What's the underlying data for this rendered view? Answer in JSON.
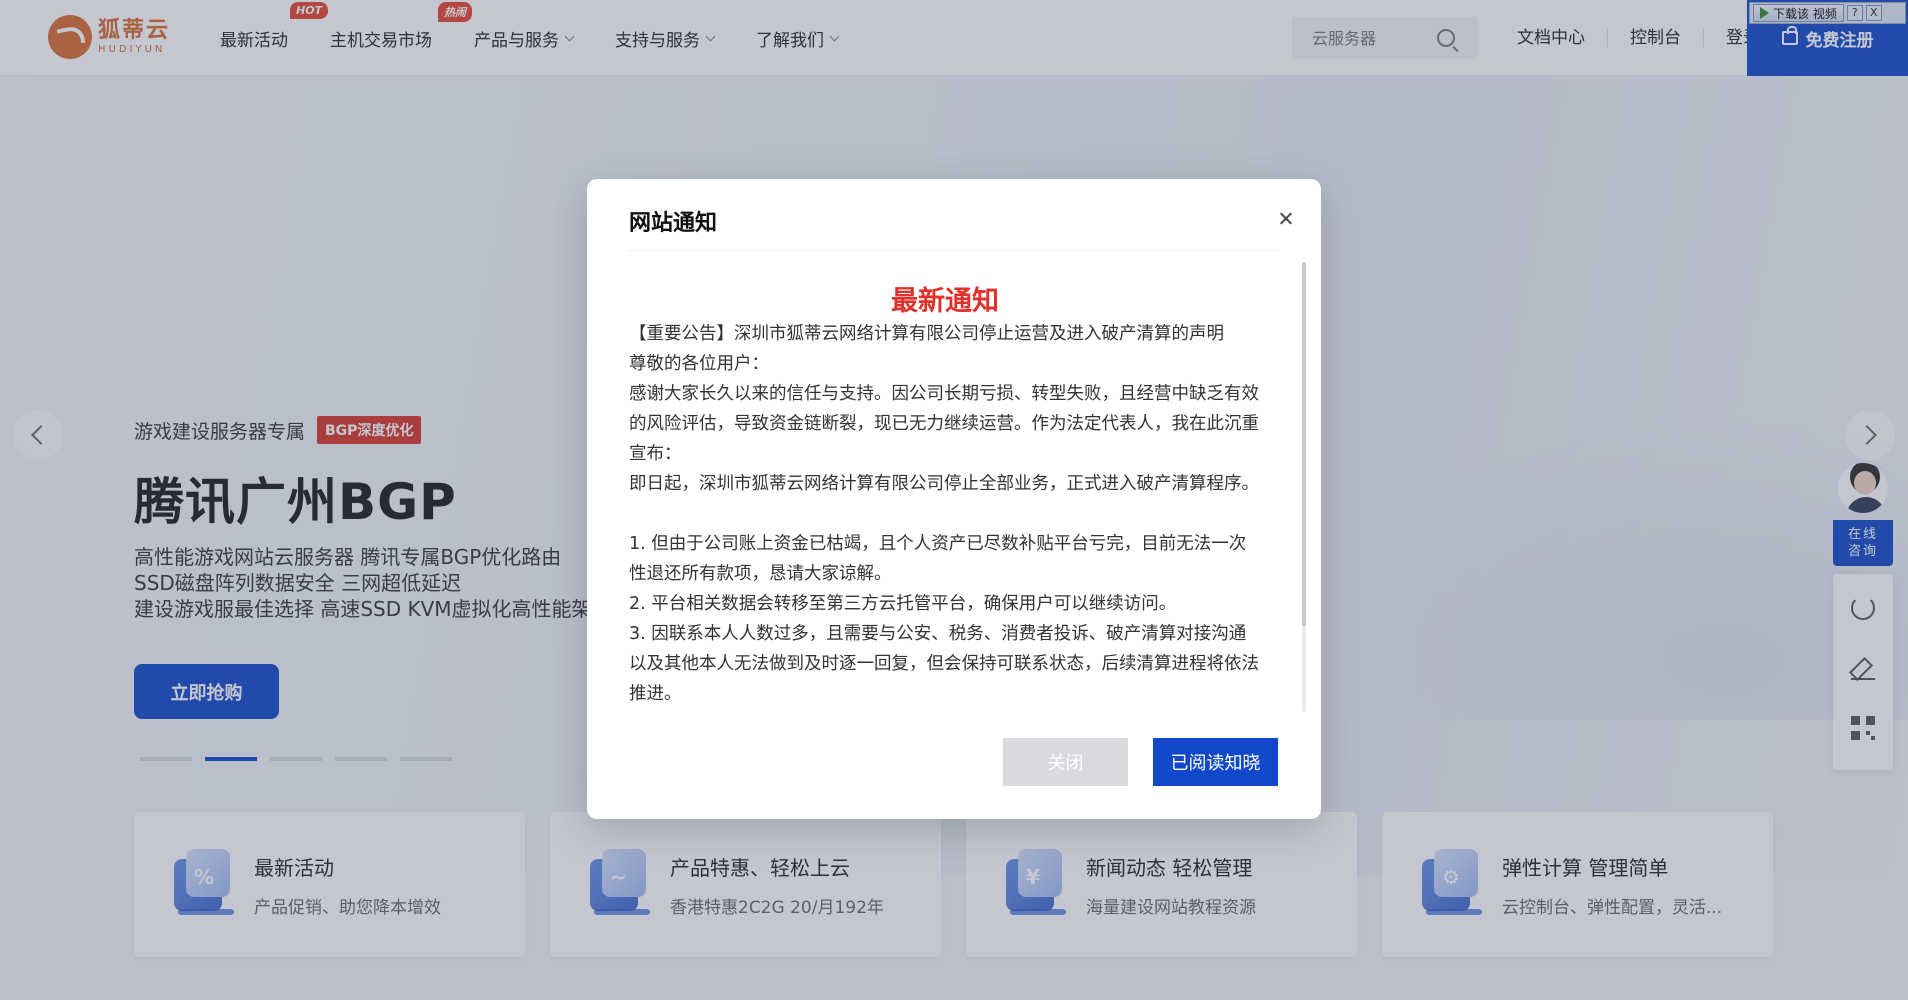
{
  "header": {
    "logo": {
      "cn": "狐蒂云",
      "en": "HUDIYUN"
    },
    "nav": [
      {
        "label": "最新活动",
        "badge": "HOT",
        "chevron": false
      },
      {
        "label": "主机交易市场",
        "badge": "热闹",
        "chevron": false
      },
      {
        "label": "产品与服务",
        "badge": "",
        "chevron": true
      },
      {
        "label": "支持与服务",
        "badge": "",
        "chevron": true
      },
      {
        "label": "了解我们",
        "badge": "",
        "chevron": true
      }
    ],
    "search": {
      "placeholder": "云服务器"
    },
    "links": [
      "文档中心",
      "控制台",
      "登录"
    ],
    "register": "免费注册",
    "video_bar": {
      "label": "下载该 视频",
      "help": "?",
      "close": "X"
    }
  },
  "hero": {
    "tagline": "游戏建设服务器专属",
    "tag": "BGP深度优化",
    "title": "腾讯广州BGP",
    "desc": [
      "高性能游戏网站云服务器 腾讯专属BGP优化路由",
      "SSD磁盘阵列数据安全 三网超低延迟",
      "建设游戏服最佳选择 高速SSD KVM虚拟化高性能架"
    ],
    "button": "立即抢购",
    "dots_total": 5,
    "active_dot": 1
  },
  "cards": [
    {
      "title": "最新活动",
      "sub": "产品促销、助您降本增效",
      "icon": "percent-icon",
      "mark": "%"
    },
    {
      "title": "产品特惠、轻松上云",
      "sub": "香港特惠2C2G 20/月192年",
      "icon": "chart-icon",
      "mark": "~"
    },
    {
      "title": "新闻动态 轻松管理",
      "sub": "海量建设网站教程资源",
      "icon": "yen-icon",
      "mark": "¥"
    },
    {
      "title": "弹性计算 管理简单",
      "sub": "云控制台、弹性配置，灵活...",
      "icon": "gear-icon",
      "mark": "⚙"
    }
  ],
  "side": {
    "consult": "在线咨询",
    "consult_lines": [
      "在线",
      "咨询"
    ]
  },
  "modal": {
    "title": "网站通知",
    "heading": "最新通知",
    "paragraphs": [
      "【重要公告】深圳市狐蒂云网络计算有限公司停止运营及进入破产清算的声明",
      "尊敬的各位用户：",
      "感谢大家长久以来的信任与支持。因公司长期亏损、转型失败，且经营中缺乏有效的风险评估，导致资金链断裂，现已无力继续运营。作为法定代表人，我在此沉重宣布：",
      "即日起，深圳市狐蒂云网络计算有限公司停止全部业务，正式进入破产清算程序。"
    ],
    "items": [
      "1. 但由于公司账上资金已枯竭，且个人资产已尽数补贴平台亏完，目前无法一次性退还所有款项，恳请大家谅解。",
      "2. 平台相关数据会转移至第三方云托管平台，确保用户可以继续访问。",
      "3. 因联系本人人数过多，且需要与公安、税务、消费者投诉、破产清算对接沟通以及其他本人无法做到及时逐一回复，但会保持可联系状态，后续清算进程将依法推进。"
    ],
    "btn_close": "关闭",
    "btn_read": "已阅读知晓"
  },
  "colors": {
    "brand": "#1148c9",
    "accent_red": "#e2302a",
    "logo_orange": "#d86a2e"
  }
}
